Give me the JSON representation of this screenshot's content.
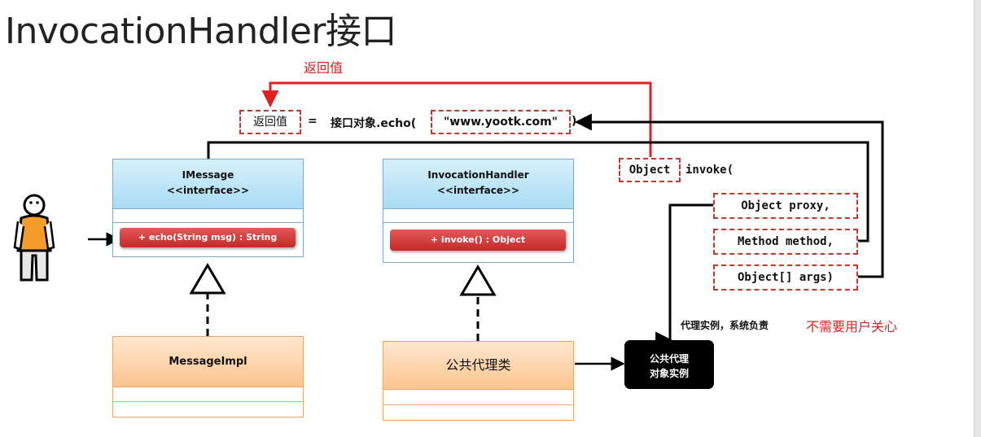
{
  "title": "InvocationHandler接口",
  "return_annotation": "返回值",
  "expression": {
    "return_box": "返回值",
    "equals": "=",
    "call_prefix": "接口对象.echo(",
    "argument": "\"www.yootk.com\"",
    "close_paren": ")"
  },
  "invoke_signature": {
    "return_type": "Object",
    "method": "invoke(",
    "params": [
      "Object proxy,",
      "Method method,",
      "Object[] args)"
    ]
  },
  "imessage": {
    "name": "IMessage",
    "stereotype": "<<interface>>",
    "method": "+ echo(String msg) : String"
  },
  "invocation_handler": {
    "name": "InvocationHandler",
    "stereotype": "<<interface>>",
    "method": "+ invoke() : Object"
  },
  "message_impl": {
    "name": "MessageImpl"
  },
  "proxy_class": {
    "name": "公共代理类"
  },
  "proxy_instance": {
    "line1": "公共代理",
    "line2": "对象实例"
  },
  "note_system": "代理实例，系统负责",
  "note_user": "不需要用户关心",
  "colors": {
    "red": "#e02020",
    "blue_head": "#a8dcf4",
    "orange_head": "#fcc48f",
    "pill": "#c62828"
  }
}
